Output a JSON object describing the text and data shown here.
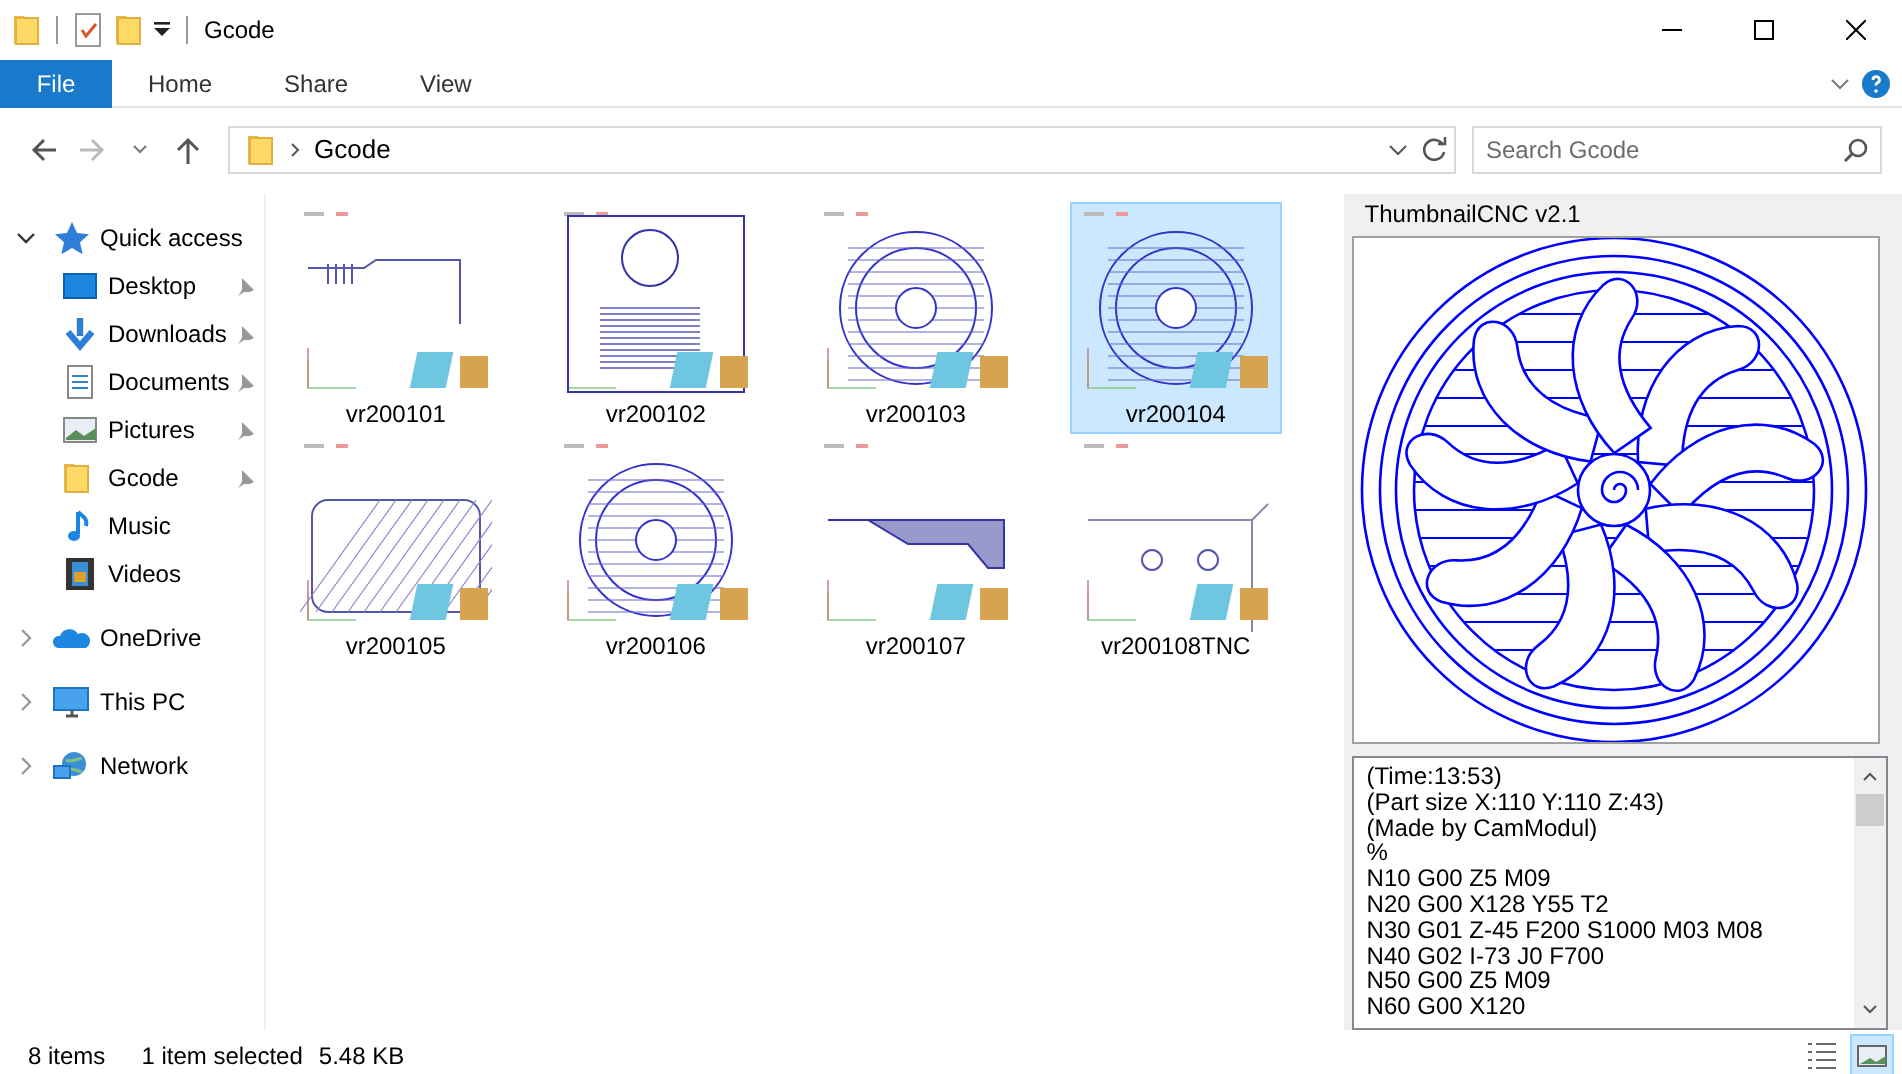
{
  "window": {
    "title": "Gcode"
  },
  "ribbon_tabs": [
    {
      "label": "File",
      "kind": "file"
    },
    {
      "label": "Home",
      "kind": "tab"
    },
    {
      "label": "Share",
      "kind": "tab"
    },
    {
      "label": "View",
      "kind": "tab"
    }
  ],
  "address_bar": {
    "path": "Gcode"
  },
  "search": {
    "placeholder": "Search Gcode"
  },
  "sidebar": {
    "items": [
      {
        "label": "Quick access",
        "expanded": true,
        "children": [
          {
            "label": "Desktop",
            "pinned": true
          },
          {
            "label": "Downloads",
            "pinned": true
          },
          {
            "label": "Documents",
            "pinned": true
          },
          {
            "label": "Pictures",
            "pinned": true
          },
          {
            "label": "Gcode",
            "pinned": true
          },
          {
            "label": "Music",
            "pinned": false
          },
          {
            "label": "Videos",
            "pinned": false
          }
        ]
      },
      {
        "label": "OneDrive",
        "expanded": false
      },
      {
        "label": "This PC",
        "expanded": false
      },
      {
        "label": "Network",
        "expanded": false
      }
    ]
  },
  "files": [
    {
      "name": "vr200101",
      "selected": false
    },
    {
      "name": "vr200102",
      "selected": false
    },
    {
      "name": "vr200103",
      "selected": false
    },
    {
      "name": "vr200104",
      "selected": true
    },
    {
      "name": "vr200105",
      "selected": false
    },
    {
      "name": "vr200106",
      "selected": false
    },
    {
      "name": "vr200107",
      "selected": false
    },
    {
      "name": "vr200108TNC",
      "selected": false
    }
  ],
  "preview": {
    "title": "ThumbnailCNC v2.1",
    "code_lines": [
      "(Time:13:53)",
      "(Part size X:110 Y:110 Z:43)",
      "(Made by CamModul)",
      "%",
      "N10 G00 Z5 M09",
      "N20 G00 X128 Y55 T2",
      "N30 G01 Z-45 F200 S1000 M03 M08",
      "N40 G02 I-73 J0 F700",
      "N50 G00 Z5 M09",
      "N60 G00 X120"
    ]
  },
  "status_bar": {
    "item_count": "8 items",
    "selection": "1 item selected",
    "size": "5.48 KB"
  },
  "view_buttons": [
    {
      "kind": "details",
      "selected": false
    },
    {
      "kind": "large-icons",
      "selected": true
    }
  ]
}
